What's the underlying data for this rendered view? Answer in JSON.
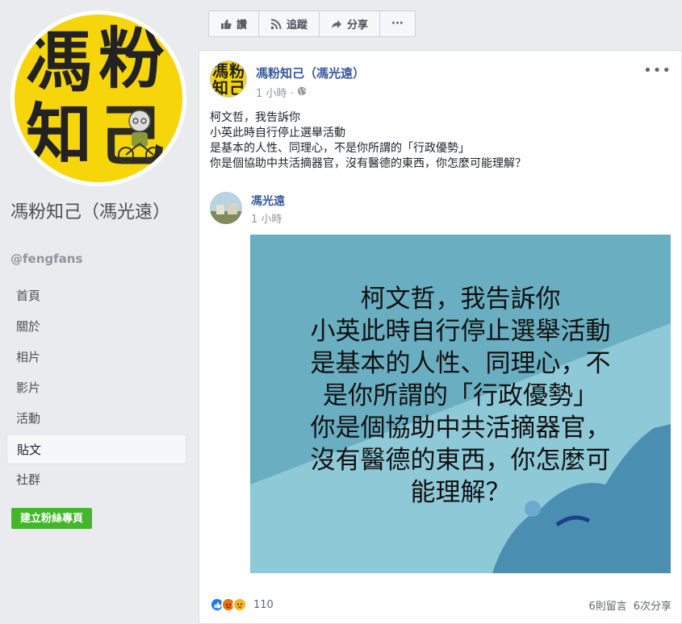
{
  "sidebar": {
    "avatar_text": [
      "馮",
      "粉",
      "知",
      "己"
    ],
    "page_name": "馮粉知己（馮光遠）",
    "handle": "@fengfans",
    "nav": [
      {
        "label": "首頁",
        "name": "nav-home"
      },
      {
        "label": "關於",
        "name": "nav-about"
      },
      {
        "label": "相片",
        "name": "nav-photos"
      },
      {
        "label": "影片",
        "name": "nav-videos"
      },
      {
        "label": "活動",
        "name": "nav-events"
      },
      {
        "label": "貼文",
        "name": "nav-posts",
        "active": true
      },
      {
        "label": "社群",
        "name": "nav-community"
      }
    ],
    "create_button": "建立粉絲專頁"
  },
  "actionbar": {
    "like": "讚",
    "follow": "追蹤",
    "share": "分享",
    "more": "···"
  },
  "post": {
    "author": "馮粉知己（馮光遠）",
    "time": "1 小時 ·",
    "avatar_text": [
      "馮",
      "粉",
      "知",
      "己"
    ],
    "lines": [
      "柯文哲，我告訴你",
      "小英此時自行停止選舉活動",
      "是基本的人性、同理心，不是你所謂的「行政優勢」",
      "你是個協助中共活摘器官，沒有醫德的東西，你怎麼可能理解？"
    ],
    "shared": {
      "author": "馮光遠",
      "time": "1 小時",
      "image_lines": [
        "柯文哲，我告訴你",
        "小英此時自行停止選舉活動",
        "是基本的人性、同理心，不",
        "是你所謂的「行政優勢」",
        "你是個協助中共活摘器官，",
        "沒有醫德的東西，你怎麼可",
        "能理解？"
      ]
    },
    "reactions_count": "110",
    "comments": "6則留言",
    "shares": "6次分享"
  },
  "colors": {
    "like": "#1877f2",
    "angry": "#e9710f",
    "sad": "#f7b125",
    "image_bg": "#6ab0c3",
    "image_light": "#8cc8d6",
    "brand_yellow": "#f6d50b"
  }
}
